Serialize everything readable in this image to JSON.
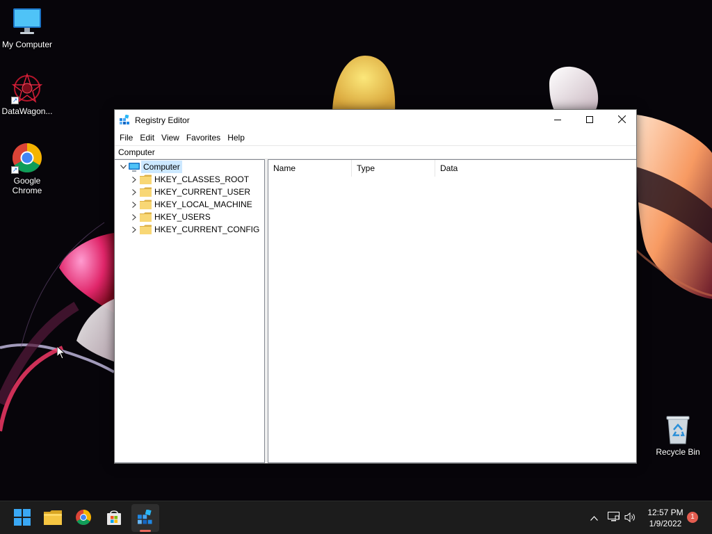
{
  "desktop": {
    "icons": [
      {
        "label": "My Computer",
        "icon": "monitor-icon"
      },
      {
        "label": "DataWagon...",
        "icon": "datawagon-icon"
      },
      {
        "label": "Google Chrome",
        "icon": "chrome-icon"
      },
      {
        "label": "Recycle Bin",
        "icon": "recycle-bin-icon"
      }
    ]
  },
  "window": {
    "title": "Registry Editor",
    "controls": {
      "minimize": "minimize-icon",
      "maximize": "maximize-icon",
      "close": "close-icon"
    },
    "menu": [
      "File",
      "Edit",
      "View",
      "Favorites",
      "Help"
    ],
    "address": "Computer",
    "tree": {
      "root": "Computer",
      "children": [
        "HKEY_CLASSES_ROOT",
        "HKEY_CURRENT_USER",
        "HKEY_LOCAL_MACHINE",
        "HKEY_USERS",
        "HKEY_CURRENT_CONFIG"
      ]
    },
    "list_columns": [
      "Name",
      "Type",
      "Data"
    ]
  },
  "taskbar": {
    "apps": [
      "windows-start-icon",
      "file-explorer-icon",
      "chrome-icon",
      "microsoft-store-icon",
      "registry-editor-icon"
    ],
    "active_app": "registry-editor-icon",
    "tray_icons": [
      "chevron-up-icon",
      "network-icon",
      "volume-icon"
    ],
    "time": "12:57 PM",
    "date": "1/9/2022",
    "notification_count": "1"
  },
  "colors": {
    "taskbar": "#1c1c1c",
    "selection": "#cce8ff",
    "folder": "#f8d775",
    "notification": "#e45d50"
  }
}
